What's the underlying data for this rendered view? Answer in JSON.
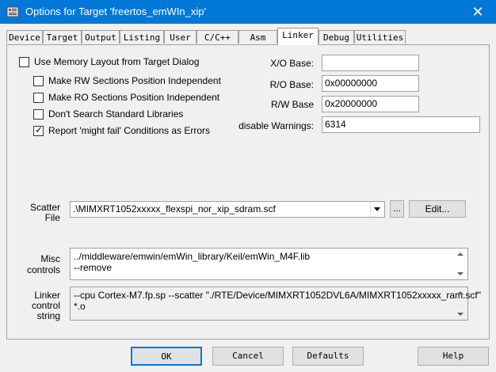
{
  "window": {
    "title": "Options for Target 'freertos_emWIn_xip'",
    "close_glyph": "✕"
  },
  "tabs": [
    {
      "label": "Device"
    },
    {
      "label": "Target"
    },
    {
      "label": "Output"
    },
    {
      "label": "Listing"
    },
    {
      "label": "User"
    },
    {
      "label": "C/C++"
    },
    {
      "label": "Asm"
    },
    {
      "label": "Linker"
    },
    {
      "label": "Debug"
    },
    {
      "label": "Utilities"
    }
  ],
  "active_tab": "Linker",
  "options": {
    "use_memory_layout": {
      "label": "Use Memory Layout from Target Dialog",
      "checked": false
    },
    "rw_independent": {
      "label": "Make RW Sections Position Independent",
      "checked": false
    },
    "ro_independent": {
      "label": "Make RO Sections Position Independent",
      "checked": false
    },
    "dont_search_std": {
      "label": "Don't Search Standard Libraries",
      "checked": false
    },
    "might_fail_errors": {
      "label": "Report 'might fail' Conditions as Errors",
      "checked": true
    }
  },
  "bases": {
    "xo_label": "X/O Base:",
    "xo_value": "",
    "ro_label": "R/O Base:",
    "ro_value": "0x00000000",
    "rw_label": "R/W Base",
    "rw_value": "0x20000000",
    "warnings_label": "disable Warnings:",
    "warnings_value": "6314"
  },
  "scatter": {
    "label_line1": "Scatter",
    "label_line2": "File",
    "value": ".\\MIMXRT1052xxxxx_flexspi_nor_xip_sdram.scf",
    "browse_label": "...",
    "edit_label": "Edit..."
  },
  "misc": {
    "label_line1": "Misc",
    "label_line2": "controls",
    "lines": [
      "../middleware/emwin/emWin_library/Keil/emWin_M4F.lib",
      "--remove"
    ]
  },
  "linker_string": {
    "label_line1": "Linker",
    "label_line2": "control",
    "label_line3": "string",
    "lines": [
      "--cpu Cortex-M7.fp.sp --scatter \"./RTE/Device/MIMXRT1052DVL6A/MIMXRT1052xxxxx_ram.scf\"",
      "*.o"
    ]
  },
  "buttons": {
    "ok": "OK",
    "cancel": "Cancel",
    "defaults": "Defaults",
    "help": "Help"
  },
  "colors": {
    "titlebar": "#0078d7",
    "dialog_bg": "#f0f0f0"
  },
  "icons": {
    "title": "keil-options-icon",
    "close": "close-icon",
    "dropdown": "chevron-down-icon"
  }
}
